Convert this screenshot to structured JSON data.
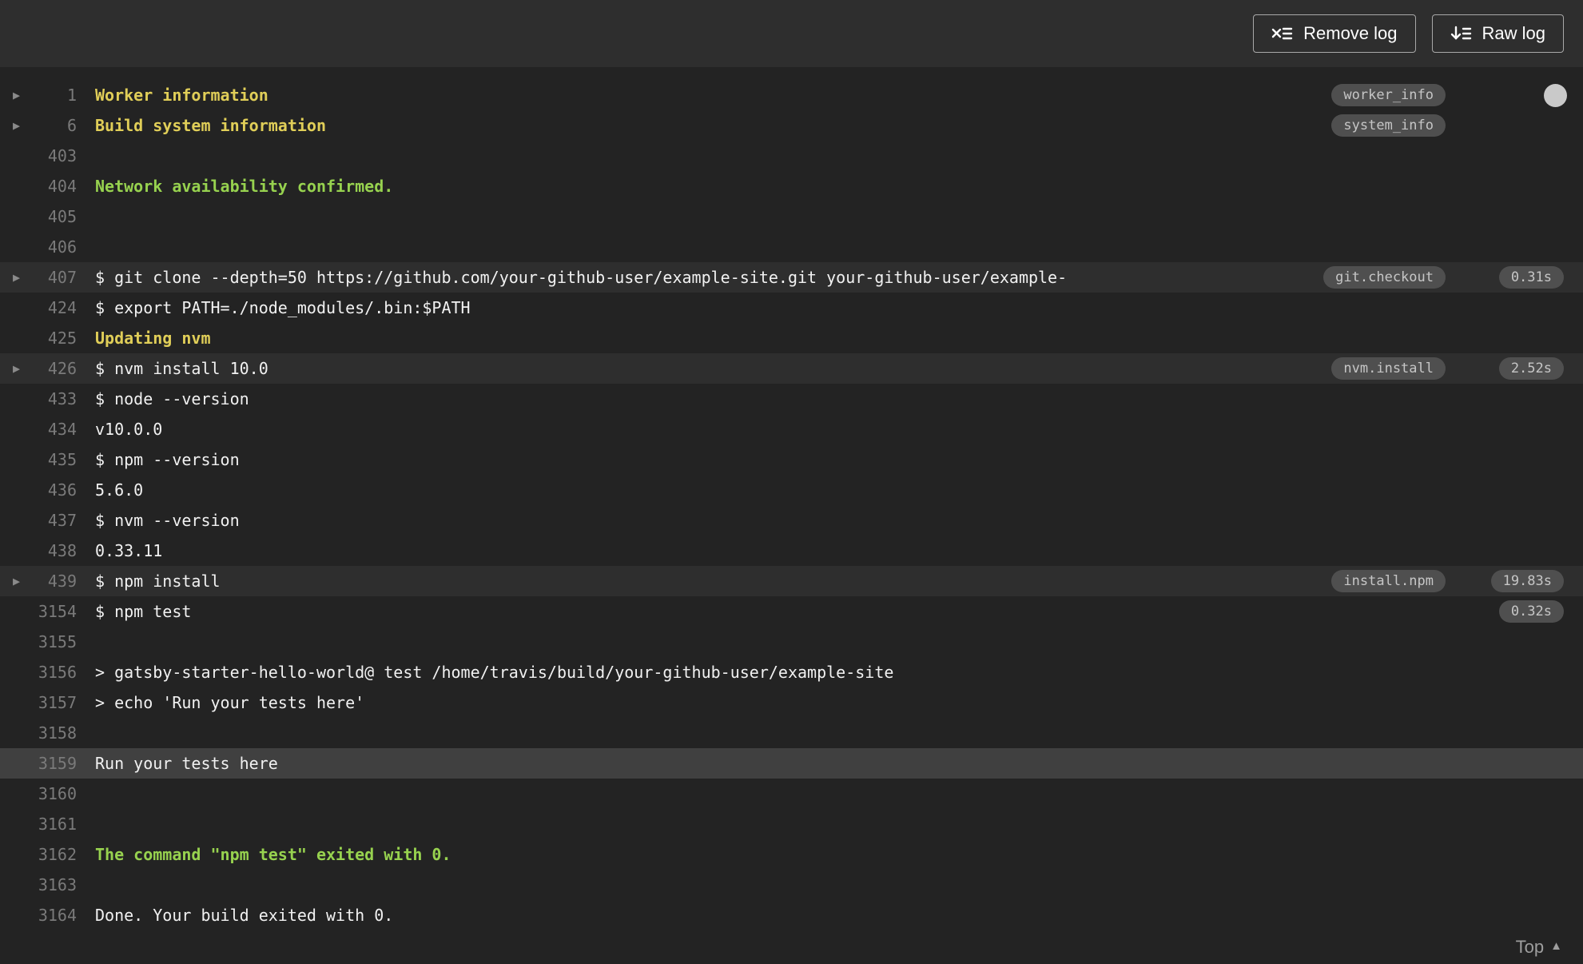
{
  "colors": {
    "header-bg": "#2e2e2e",
    "log-bg": "#232323",
    "row-hl": "#2e2e2e",
    "row-sel": "#404040",
    "yellow": "#e0ce58",
    "green": "#97d24f",
    "pill-bg": "#4f4f4f"
  },
  "toolbar": {
    "remove_log": "Remove log",
    "raw_log": "Raw log"
  },
  "log": {
    "lines": [
      {
        "number": "1",
        "text": "Worker information",
        "style": "yellow",
        "fold": true,
        "tag": "worker_info",
        "scroll_dot": true
      },
      {
        "number": "6",
        "text": "Build system information",
        "style": "yellow",
        "fold": true,
        "tag": "system_info"
      },
      {
        "number": "403",
        "text": ""
      },
      {
        "number": "404",
        "text": "Network availability confirmed.",
        "style": "green"
      },
      {
        "number": "405",
        "text": ""
      },
      {
        "number": "406",
        "text": ""
      },
      {
        "number": "407",
        "text": "$ git clone --depth=50 https://github.com/your-github-user/example-site.git your-github-user/example-",
        "fold": true,
        "tag": "git.checkout",
        "duration": "0.31s",
        "highlight": "row"
      },
      {
        "number": "424",
        "text": "$ export PATH=./node_modules/.bin:$PATH"
      },
      {
        "number": "425",
        "text": "Updating nvm",
        "style": "yellow"
      },
      {
        "number": "426",
        "text": "$ nvm install 10.0",
        "fold": true,
        "tag": "nvm.install",
        "duration": "2.52s",
        "highlight": "row"
      },
      {
        "number": "433",
        "text": "$ node --version"
      },
      {
        "number": "434",
        "text": "v10.0.0"
      },
      {
        "number": "435",
        "text": "$ npm --version"
      },
      {
        "number": "436",
        "text": "5.6.0"
      },
      {
        "number": "437",
        "text": "$ nvm --version"
      },
      {
        "number": "438",
        "text": "0.33.11"
      },
      {
        "number": "439",
        "text": "$ npm install",
        "fold": true,
        "tag": "install.npm",
        "duration": "19.83s",
        "highlight": "row"
      },
      {
        "number": "3154",
        "text": "$ npm test",
        "duration": "0.32s"
      },
      {
        "number": "3155",
        "text": ""
      },
      {
        "number": "3156",
        "text": "> gatsby-starter-hello-world@ test /home/travis/build/your-github-user/example-site"
      },
      {
        "number": "3157",
        "text": "> echo 'Run your tests here'"
      },
      {
        "number": "3158",
        "text": ""
      },
      {
        "number": "3159",
        "text": "Run your tests here",
        "highlight": "selected"
      },
      {
        "number": "3160",
        "text": ""
      },
      {
        "number": "3161",
        "text": ""
      },
      {
        "number": "3162",
        "text": "The command \"npm test\" exited with 0.",
        "style": "green"
      },
      {
        "number": "3163",
        "text": ""
      },
      {
        "number": "3164",
        "text": "Done. Your build exited with 0."
      }
    ]
  },
  "footer": {
    "top_label": "Top"
  }
}
